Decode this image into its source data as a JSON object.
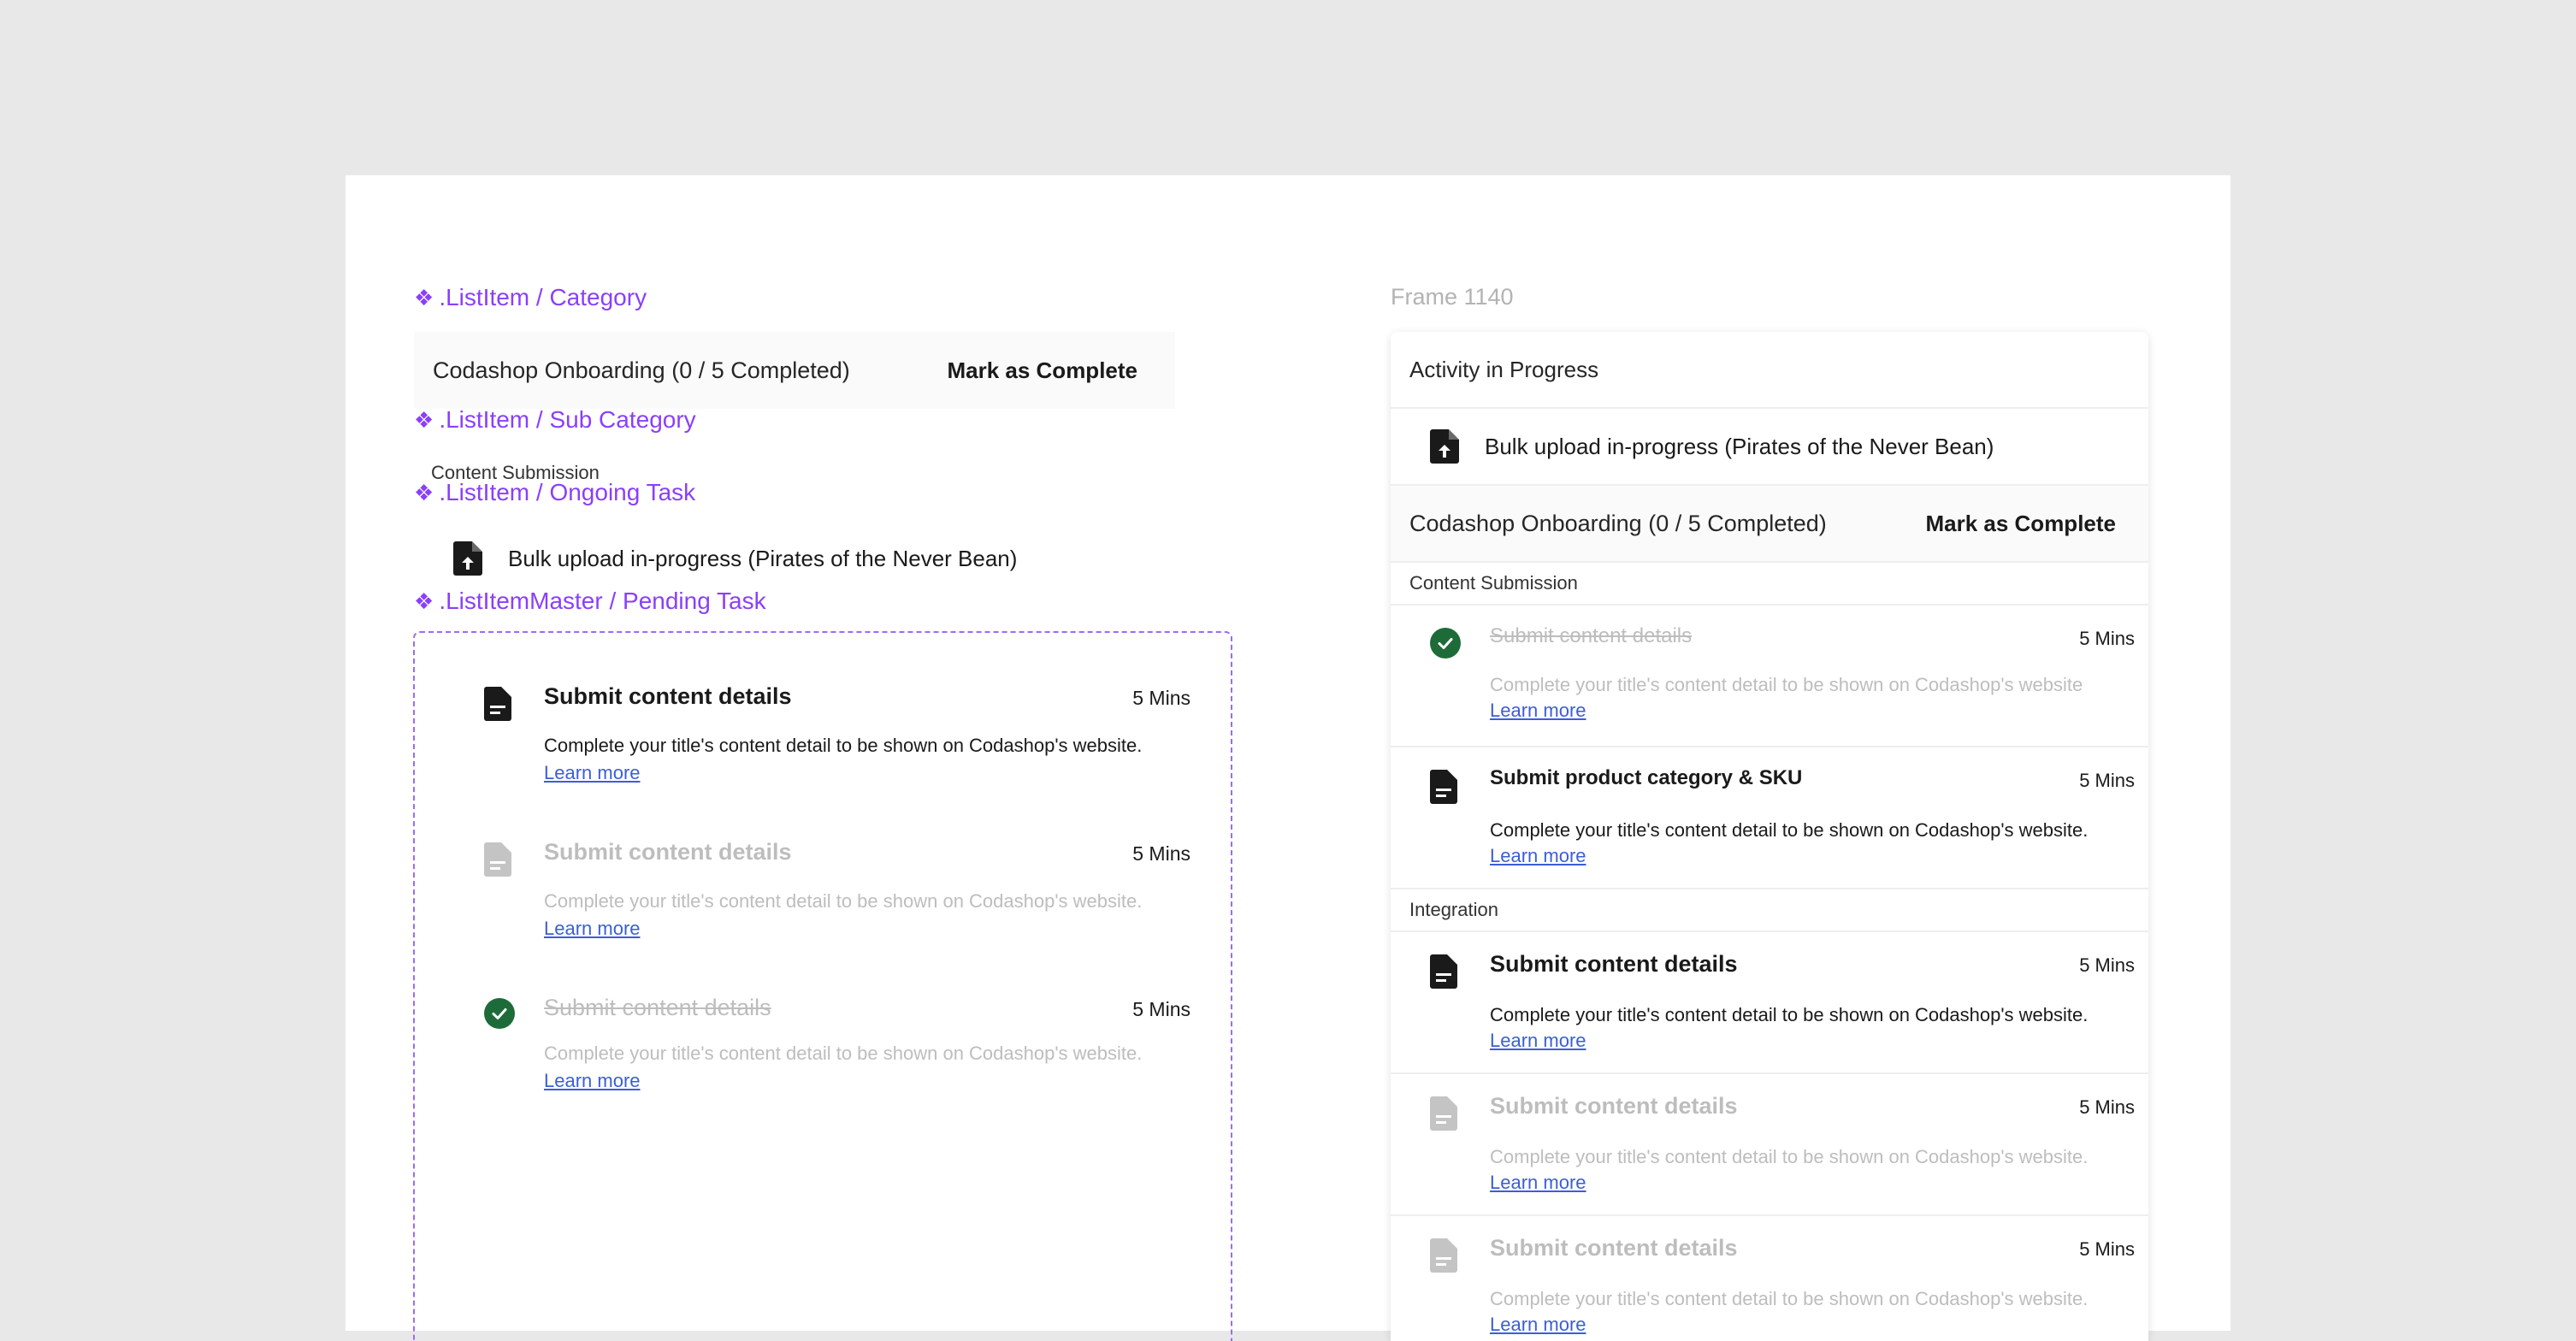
{
  "labels": {
    "category": ".ListItem / Category",
    "sub_category": ".ListItem / Sub Category",
    "ongoing_task": ".ListItem / Ongoing Task",
    "pending_task": ".ListItemMaster / Pending Task",
    "frame": "Frame 1140"
  },
  "left": {
    "category_title": "Codashop Onboarding (0 / 5 Completed)",
    "category_action": "Mark as Complete",
    "sub_category_text": "Content Submission",
    "ongoing_text": "Bulk upload in-progress (Pirates of the Never Bean)",
    "tasks": [
      {
        "title": "Submit content details",
        "mins": "5 Mins",
        "desc": "Complete your title's content detail to be shown on Codashop's website.",
        "learn": "Learn more"
      },
      {
        "title": "Submit content details",
        "mins": "5 Mins",
        "desc": "Complete your title's content detail to be shown on Codashop's website.",
        "learn": "Learn more"
      },
      {
        "title": "Submit content details",
        "mins": "5 Mins",
        "desc": "Complete your title's content detail to be shown on Codashop's website.",
        "learn": "Learn more"
      }
    ]
  },
  "panel": {
    "header": "Activity in Progress",
    "ongoing_text": "Bulk upload in-progress (Pirates of the Never Bean)",
    "category_title": "Codashop Onboarding (0 / 5 Completed)",
    "category_action": "Mark as Complete",
    "section1": "Content Submission",
    "section2": "Integration",
    "tasks": [
      {
        "title": "Submit content details",
        "mins": "5 Mins",
        "desc": "Complete your title's content detail to be shown on Codashop's website",
        "learn": "Learn more"
      },
      {
        "title": "Submit product category & SKU",
        "mins": "5 Mins",
        "desc": "Complete your title's content detail to be shown on Codashop's website.",
        "learn": "Learn more"
      },
      {
        "title": "Submit content details",
        "mins": "5 Mins",
        "desc": "Complete your title's content detail to be shown on Codashop's website.",
        "learn": "Learn more"
      },
      {
        "title": "Submit content details",
        "mins": "5 Mins",
        "desc": "Complete your title's content detail to be shown on Codashop's website.",
        "learn": "Learn more"
      },
      {
        "title": "Submit content details",
        "mins": "5 Mins",
        "desc": "Complete your title's content detail to be shown on Codashop's website.",
        "learn": "Learn more"
      }
    ]
  },
  "colors": {
    "component_purple": "#8a3ffc",
    "link_blue": "#3b5ed8",
    "done_green": "#1e6b3a",
    "disabled_gray": "#bdbdbd"
  },
  "icons": {
    "component": "component-diamond-icon",
    "document": "document-icon",
    "upload": "file-upload-icon",
    "check": "check-circle-icon"
  }
}
